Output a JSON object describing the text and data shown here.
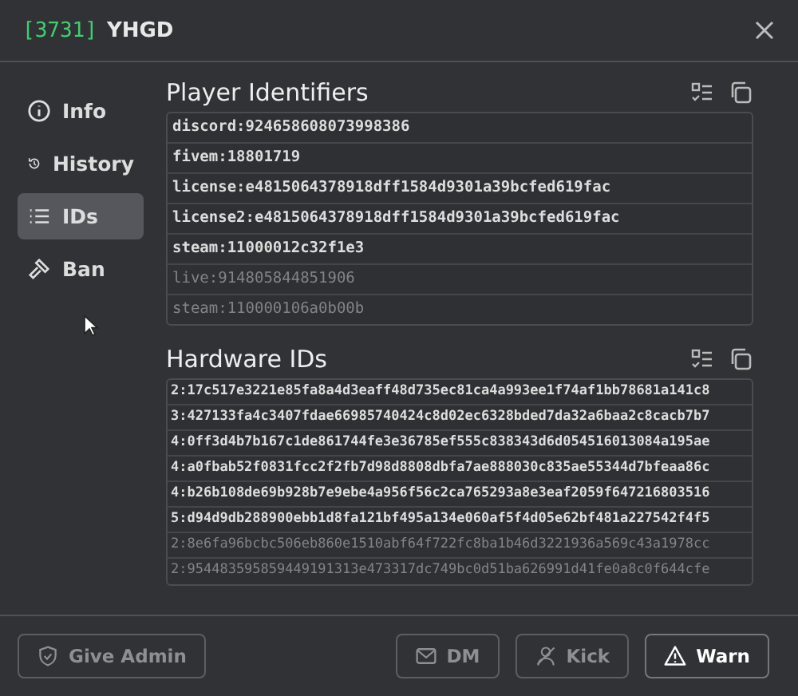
{
  "window": {
    "id": "[3731]",
    "title": "YHGD"
  },
  "sidebar": {
    "items": [
      {
        "label": "Info",
        "kind": "info",
        "selected": false
      },
      {
        "label": "History",
        "kind": "history",
        "selected": false
      },
      {
        "label": "IDs",
        "kind": "list",
        "selected": true
      },
      {
        "label": "Ban",
        "kind": "hammer",
        "selected": false
      }
    ]
  },
  "sections": [
    {
      "title": "Player Identifiers",
      "rows": [
        {
          "text": "discord:924658608073998386",
          "dim": false
        },
        {
          "text": "fivem:18801719",
          "dim": false
        },
        {
          "text": "license:e4815064378918dff1584d9301a39bcfed619fac",
          "dim": false
        },
        {
          "text": "license2:e4815064378918dff1584d9301a39bcfed619fac",
          "dim": false
        },
        {
          "text": "steam:11000012c32f1e3",
          "dim": false
        },
        {
          "text": "live:914805844851906",
          "dim": true
        },
        {
          "text": "steam:110000106a0b00b",
          "dim": true
        }
      ]
    },
    {
      "title": "Hardware IDs",
      "rows": [
        {
          "text": "2:17c517e3221e85fa8a4d3eaff48d735ec81ca4a993ee1f74af1bb78681a141c8",
          "dim": false
        },
        {
          "text": "3:427133fa4c3407fdae66985740424c8d02ec6328bded7da32a6baa2c8cacb7b7",
          "dim": false
        },
        {
          "text": "4:0ff3d4b7b167c1de861744fe3e36785ef555c838343d6d054516013084a195ae",
          "dim": false
        },
        {
          "text": "4:a0fbab52f0831fcc2f2fb7d98d8808dbfa7ae888030c835ae55344d7bfeaa86c",
          "dim": false
        },
        {
          "text": "4:b26b108de69b928b7e9ebe4a956f56c2ca765293a8e3eaf2059f647216803516",
          "dim": false
        },
        {
          "text": "5:d94d9db288900ebb1d8fa121bf495a134e060af5f4d05e62bf481a227542f4f5",
          "dim": false
        },
        {
          "text": "2:8e6fa96bcbc506eb860e1510abf64f722fc8ba1b46d3221936a569c43a1978cc",
          "dim": true
        },
        {
          "text": "2:954483595859449191313e473317dc749bc0d51ba626991d41fe0a8c0f644cfe",
          "dim": true
        }
      ]
    }
  ],
  "buttons": [
    {
      "label": "Give Admin",
      "kind": "admin",
      "disabled": true
    },
    {
      "label": "DM",
      "kind": "dm",
      "disabled": true
    },
    {
      "label": "Kick",
      "kind": "kick",
      "disabled": true
    },
    {
      "label": "Warn",
      "kind": "warn",
      "disabled": false
    }
  ]
}
